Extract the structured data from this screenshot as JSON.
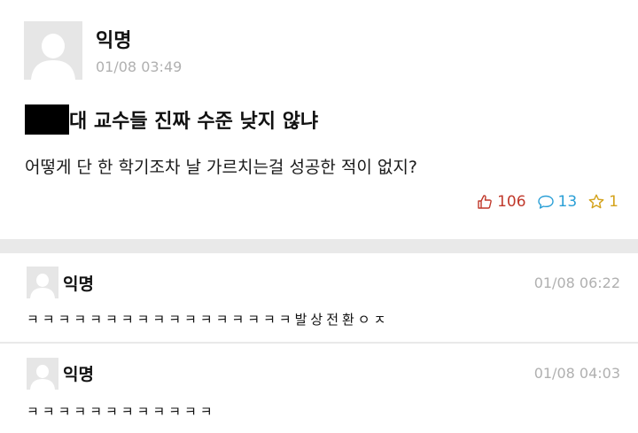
{
  "post": {
    "author": "익명",
    "time": "01/08 03:49",
    "title": "대 교수들 진짜 수준 낮지 않냐",
    "body": "어떻게 단 한 학기조차 날 가르치는걸 성공한 적이 없지?",
    "likes": "106",
    "comments": "13",
    "scraps": "1"
  },
  "comments": [
    {
      "author": "익명",
      "time": "01/08 06:22",
      "text": "ㅋㅋㅋㅋㅋㅋㅋㅋㅋㅋㅋㅋㅋㅋㅋㅋㅋ발상전환ㅇㅈ"
    },
    {
      "author": "익명",
      "time": "01/08 04:03",
      "text": "ㅋㅋㅋㅋㅋㅋㅋㅋㅋㅋㅋㅋ"
    }
  ],
  "colors": {
    "like": "#c0392b",
    "comment": "#2a9fd6",
    "scrap": "#d4a21a",
    "meta": "#b0b0b0",
    "separator": "#e9e9e9"
  },
  "icons": [
    "avatar-icon",
    "thumbs-up-icon",
    "speech-bubble-icon",
    "star-icon"
  ]
}
